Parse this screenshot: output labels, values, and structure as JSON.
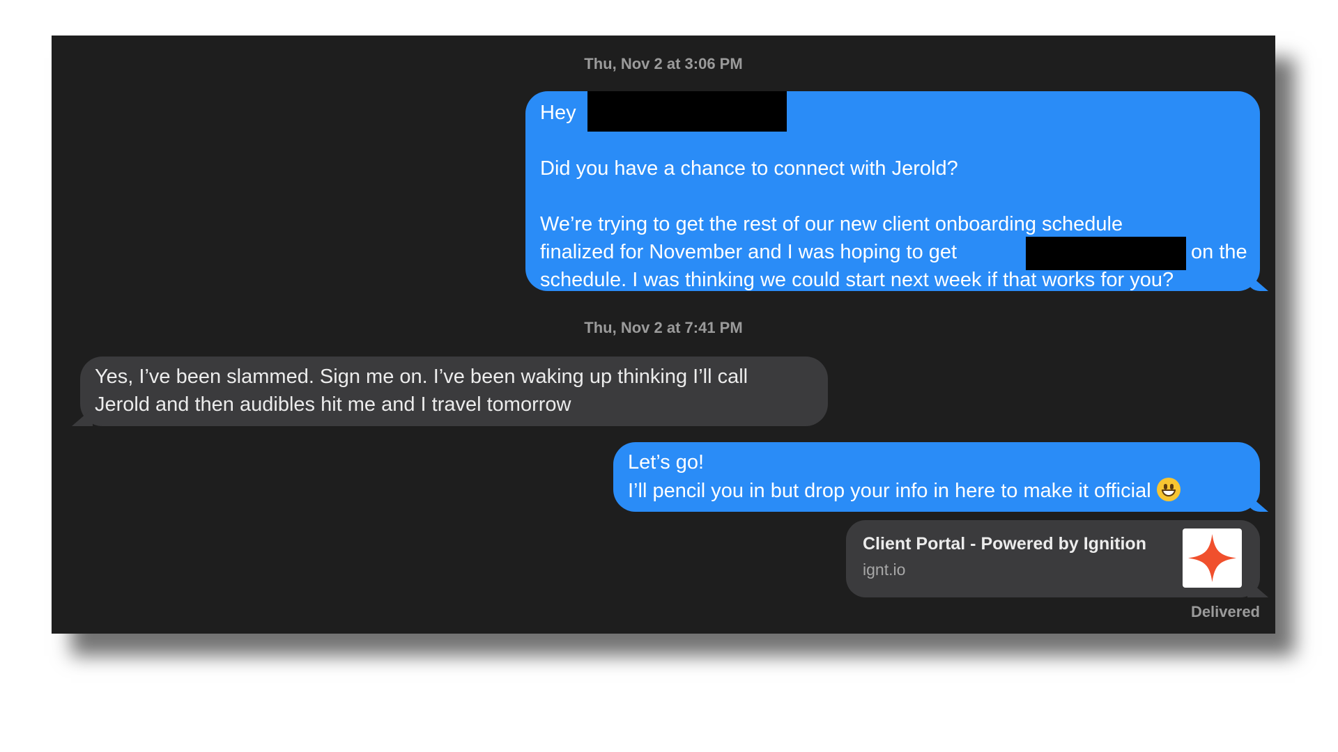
{
  "timestamps": [
    "Thu, Nov 2 at 3:06 PM",
    "Thu, Nov 2 at 7:41 PM"
  ],
  "messages": {
    "m1": {
      "greeting": "Hey",
      "question": "Did you have a chance to connect with Jerold?",
      "line3": "We’re trying to get the rest of our new client onboarding schedule",
      "line4a": "finalized for November and I was hoping to get",
      "line4b": "on the",
      "line5": "schedule. I was thinking we could start next week if that works for you?"
    },
    "m2": {
      "line1": "Yes, I’ve been slammed. Sign me on. I’ve been waking up thinking I’ll call",
      "line2": "Jerold and then audibles hit me and I travel tomorrow"
    },
    "m3": {
      "line1": "Let’s go!",
      "line2": "I’ll pencil you in but drop your info in here to make it official"
    }
  },
  "link_preview": {
    "title": "Client Portal - Powered by Ignition",
    "url": "ignt.io",
    "icon": "ignition-star-icon",
    "icon_color": "#f0502d"
  },
  "status": "Delivered",
  "colors": {
    "sent_bubble": "#2a8cf7",
    "received_bubble": "#3b3b3d",
    "background": "#1e1e1e"
  }
}
